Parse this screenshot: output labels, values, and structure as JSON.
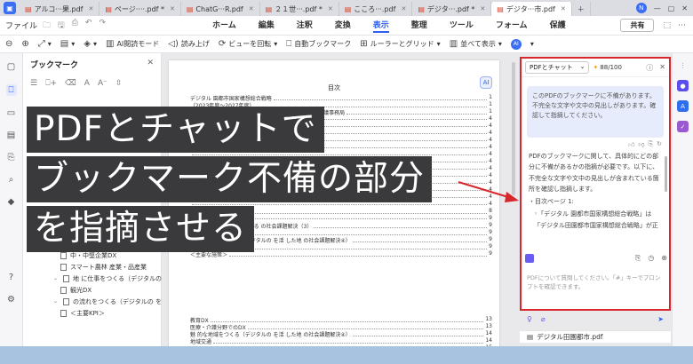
{
  "tabs": [
    {
      "label": "アルコ···果.pdf",
      "active": false
    },
    {
      "label": "ページ····.pdf *",
      "active": false
    },
    {
      "label": "ChatG···R.pdf",
      "active": false
    },
    {
      "label": "２１世···.pdf *",
      "active": false
    },
    {
      "label": "こころ···.pdf",
      "active": false
    },
    {
      "label": "デジタ···.pdf *",
      "active": false
    },
    {
      "label": "デジタ···市.pdf",
      "active": true
    }
  ],
  "menu": {
    "file": "ファイル",
    "items": [
      "ホーム",
      "編集",
      "注釈",
      "変換",
      "表示",
      "整理",
      "ツール",
      "フォーム",
      "保護"
    ],
    "active": "表示",
    "share": "共有"
  },
  "toolbar": {
    "ai_read_mode": "AI閲読モード",
    "read_aloud": "読み上げ",
    "rotate_view": "ビューを回転",
    "auto_bookmark": "自動ブックマーク",
    "ruler_grid": "ルーラーとグリッド",
    "arrange_view": "並べて表示"
  },
  "bookmark_panel": {
    "title": "ブックマーク",
    "items": [
      {
        "label": "＜主要な施策＞",
        "indent": 2,
        "chevron": false
      },
      {
        "label": "中・中堅企業DX",
        "indent": 2,
        "chevron": false
      },
      {
        "label": "スマート農林 産業・品産業",
        "indent": 2,
        "chevron": false
      },
      {
        "label": "地 に仕事をつくる（デジタルの を活",
        "indent": 1,
        "chevron": true
      },
      {
        "label": "観光DX",
        "indent": 2,
        "chevron": false
      },
      {
        "label": "の流れをつくる（デジタルの を活 し",
        "indent": 1,
        "chevron": true
      },
      {
        "label": "＜主要KPI＞",
        "indent": 2,
        "chevron": false
      }
    ]
  },
  "document": {
    "page_title": "目次",
    "toc": [
      {
        "text": "デジタル 園都市国家構想総合戦略",
        "num": "1"
      },
      {
        "text": "（2023年度〜2027年度）",
        "num": "1"
      },
      {
        "text": "2022年12 23 内閣官房デジタル 園都市国家構想実現会議事務局",
        "num": "1"
      },
      {
        "text": "",
        "num": "4"
      },
      {
        "text": "",
        "num": "4"
      },
      {
        "text": "",
        "num": "4"
      },
      {
        "text": "",
        "num": "4"
      },
      {
        "text": "",
        "num": "4"
      },
      {
        "text": "",
        "num": "4"
      },
      {
        "text": "",
        "num": "4"
      },
      {
        "text": "",
        "num": "4"
      },
      {
        "text": "",
        "num": "4"
      },
      {
        "text": "",
        "num": "4"
      },
      {
        "text": "",
        "num": "4"
      },
      {
        "text": "",
        "num": "4"
      },
      {
        "text": "",
        "num": "4"
      },
      {
        "text": "少 化対策の総合的な推進",
        "num": "8"
      },
      {
        "text": "",
        "num": "9"
      },
      {
        "text": "仕事 と育てを両 など 関する の社会課題解決（3）",
        "num": "9"
      },
      {
        "text": "＜主要KPI＞",
        "num": "9"
      },
      {
        "text": "魅 的な地域をつくる（デジタルの を活 した地 の社会課題解決④）",
        "num": "9"
      },
      {
        "text": "＜主要KPI＞",
        "num": "9"
      },
      {
        "text": "＜主要な施策＞",
        "num": "9"
      },
      {
        "text": "教育DX",
        "num": "13"
      },
      {
        "text": "医療・介護分野でのDX",
        "num": "13"
      },
      {
        "text": "魅 的な地域をつくる（デジタルの を活 した地 の社会課題解決④）",
        "num": "14"
      },
      {
        "text": "地域交通",
        "num": "14"
      },
      {
        "text": "",
        "num": "15"
      }
    ]
  },
  "chat": {
    "mode": "PDFとチャット",
    "credits": "88/100",
    "question": "このPDFのブックマークに不備があります。不完全な文字や文中の見出しがあります。確認して指摘してください。",
    "answer_paragraph": "PDFのブックマークに関して、具体的にどの部分に不備があるかの指摘が必要です。以下に、不完全な文字や文中の見出しが含まれている箇所を確認し指摘します。",
    "answer_item1": "・目次ページ 1:",
    "answer_item2": "◦「デジタル 園都市国家構想総合戦略」は「デジタル田園都市国家構想総合戦略」が正",
    "input_placeholder": "PDFについて質問してください。「#」キーでプロンプトを確認できます。",
    "file_chip": "デジタル田園都市.pdf"
  },
  "overlay": {
    "line1": "PDFとチャットで",
    "line2": "ブックマーク不備の部分",
    "line3": "を指摘させる"
  },
  "colors": {
    "accent": "#2d5ef0",
    "highlight_border": "#d9262c",
    "overlay_bg": "#3a3a3d"
  }
}
